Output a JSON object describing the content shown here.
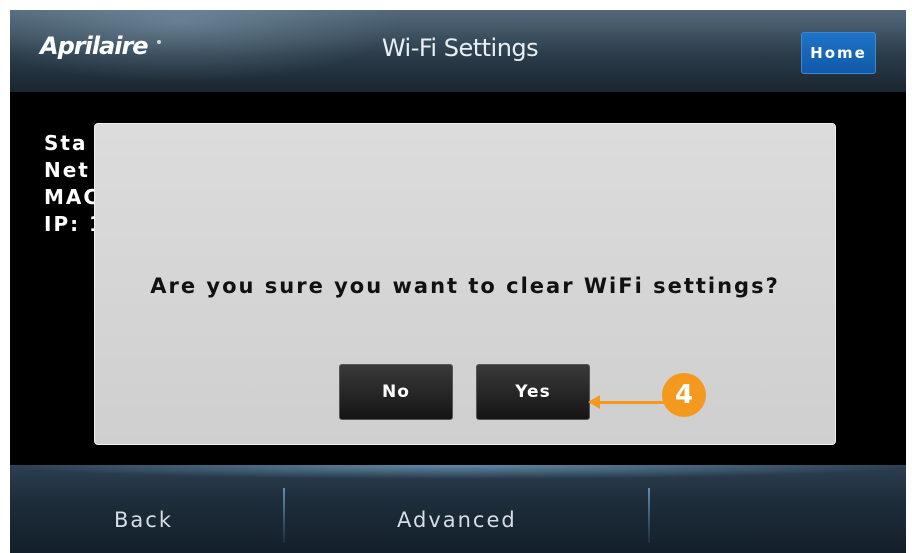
{
  "header": {
    "logo_text": "Aprilaire",
    "title": "Wi-Fi Settings",
    "home_label": "Home"
  },
  "status": {
    "lines": [
      "Sta",
      "Net",
      "MAC",
      "IP: 1"
    ]
  },
  "dialog": {
    "message": "Are you sure you want to clear WiFi settings?",
    "no_label": "No",
    "yes_label": "Yes"
  },
  "callout": {
    "number": "4",
    "color": "#f39a1e"
  },
  "footer": {
    "back_label": "Back",
    "advanced_label": "Advanced"
  },
  "colors": {
    "home_button": "#1f73c8",
    "dialog_bg": "#d8d8d8",
    "screen_bg": "#000000"
  }
}
